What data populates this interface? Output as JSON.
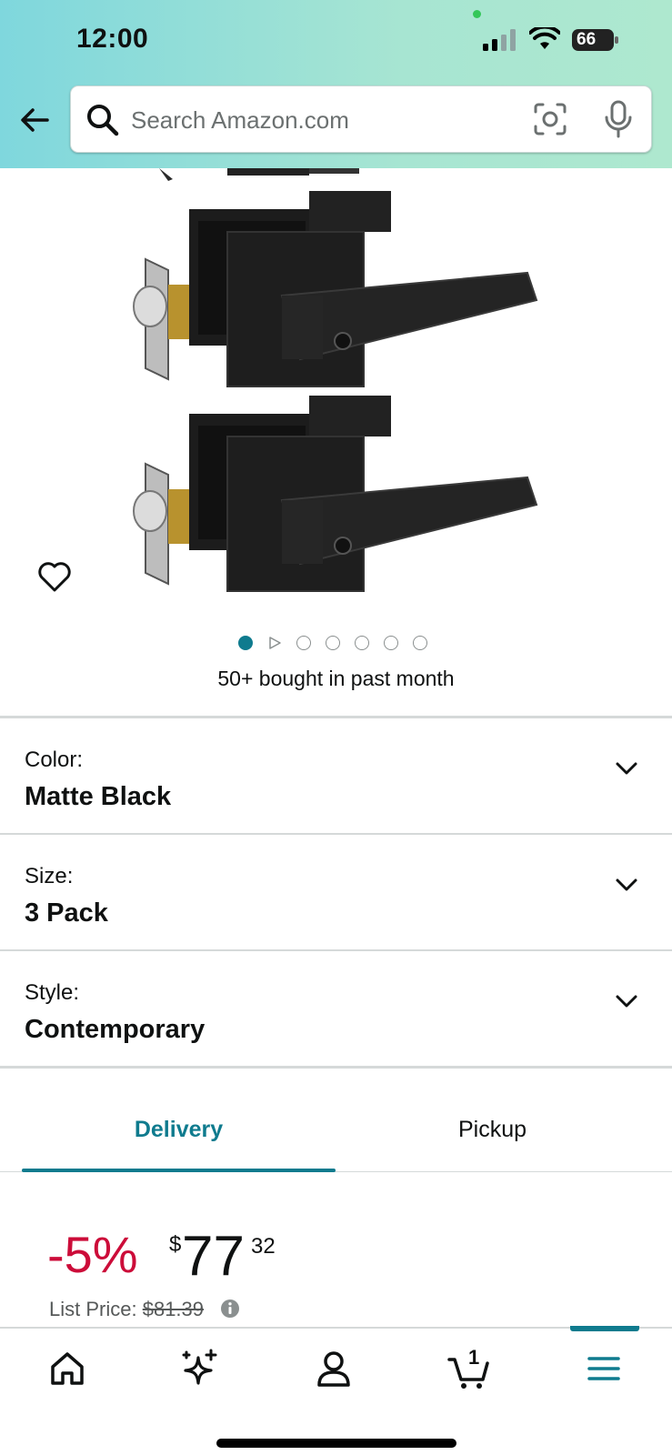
{
  "status_bar": {
    "time": "12:00",
    "battery": "66"
  },
  "search": {
    "placeholder": "Search Amazon.com"
  },
  "carousel": {
    "active_index": 0,
    "total_dots": 7
  },
  "bought_text": "50+ bought in past month",
  "variants": [
    {
      "label": "Color:",
      "value": "Matte Black"
    },
    {
      "label": "Size:",
      "value": "3 Pack"
    },
    {
      "label": "Style:",
      "value": "Contemporary"
    }
  ],
  "tabs": {
    "delivery": "Delivery",
    "pickup": "Pickup",
    "active": "Delivery"
  },
  "price": {
    "discount": "-5%",
    "currency": "$",
    "whole": "77",
    "fraction": "32",
    "list_price_label": "List Price:",
    "list_price_value": "$81.39"
  },
  "cart": {
    "count": "1"
  },
  "colors": {
    "accent": "#0f7b8e",
    "discount": "#cc0c39"
  },
  "icons": [
    "back-arrow-icon",
    "search-icon",
    "camera-lens-icon",
    "microphone-icon",
    "heart-icon",
    "chevron-down-icon",
    "info-icon",
    "home-icon",
    "sparkle-icon",
    "account-icon",
    "cart-icon",
    "menu-icon"
  ]
}
